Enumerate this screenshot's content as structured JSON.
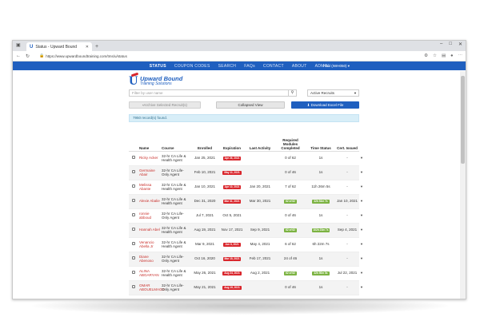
{
  "browser": {
    "tab_title": "Status - Upward Bound",
    "url": "https://www.upwardboundtraining.com/tms/u/status"
  },
  "site": {
    "nav": [
      "STATUS",
      "COUPON CODES",
      "SEARCH",
      "FAQs",
      "CONTACT",
      "ABOUT",
      "ADMIN"
    ],
    "user": "Paul (IWH050)",
    "logo_line1": "Upward Bound",
    "logo_line2": "Training Solutions"
  },
  "controls": {
    "search_placeholder": "Filter by user name",
    "filter_value": "Active Recruits",
    "archive_label": "Archive Selected Recruit(s)",
    "collapsed_label": "Collapsed View",
    "excel_label": "Download Excel File"
  },
  "alert": "7950 record(s) found.",
  "table": {
    "headers": [
      "Name",
      "Course",
      "Enrolled",
      "Expiration",
      "Last Activity",
      "Required Modules Completed",
      "Time Status",
      "Cert. Issued"
    ],
    "rows": [
      {
        "name": "Ricky Acker",
        "course": "32-hr CA Life & Health Agent",
        "enrolled": "Jan 25, 2021",
        "expiration": "Apr 26, 2021",
        "exp_color": "red",
        "last_activity": "",
        "modules": "0 of 62",
        "modules_badge": false,
        "time": "1s",
        "time_badge": false,
        "cert": "-"
      },
      {
        "name": "Germaine Abair",
        "course": "32-hr CA Life-Only Agent",
        "enrolled": "Feb 10, 2021",
        "expiration": "May 11, 2021",
        "exp_color": "red",
        "last_activity": "",
        "modules": "0 of 46",
        "modules_badge": false,
        "time": "1s",
        "time_badge": false,
        "cert": "-"
      },
      {
        "name": "Melissa Abante",
        "course": "32-hr CA Life & Health Agent",
        "enrolled": "Jan 10, 2021",
        "expiration": "Apr 10, 2021",
        "exp_color": "red",
        "last_activity": "Jan 20, 2021",
        "modules": "7 of 62",
        "modules_badge": false,
        "time": "11h 26m 5s",
        "time_badge": false,
        "cert": "-"
      },
      {
        "name": "Alexie Abalie",
        "course": "32-hr CA Life & Health Agent",
        "enrolled": "Dec 31, 2020",
        "expiration": "Mar 31, 2021",
        "exp_color": "red",
        "last_activity": "Mar 30, 2021",
        "modules": "62 of 62",
        "modules_badge": true,
        "time": "32h 54m 7s",
        "time_badge": true,
        "cert": "Jan 10, 2021"
      },
      {
        "name": "ronnie abboud",
        "course": "32-hr CA Life-Only Agent",
        "enrolled": "Jul 7, 2021",
        "expiration": "Oct 5, 2021",
        "exp_color": "none",
        "last_activity": "",
        "modules": "0 of 46",
        "modules_badge": false,
        "time": "1s",
        "time_badge": false,
        "cert": "-"
      },
      {
        "name": "Hannah Abel",
        "course": "32-hr CA Life & Health Agent",
        "enrolled": "Aug 19, 2021",
        "expiration": "Nov 17, 2021",
        "exp_color": "none",
        "last_activity": "Sep 9, 2021",
        "modules": "62 of 62",
        "modules_badge": true,
        "time": "102h 23m 7s",
        "time_badge": true,
        "cert": "Sep 4, 2021"
      },
      {
        "name": "Venancio Abella Jr",
        "course": "32-hr CA Life & Health Agent",
        "enrolled": "Mar 9, 2021",
        "expiration": "Jun 8, 2021",
        "exp_color": "red",
        "last_activity": "May 4, 2021",
        "modules": "6 of 62",
        "modules_badge": false,
        "time": "6h 22m 7s",
        "time_badge": false,
        "cert": "-"
      },
      {
        "name": "Diane Abenoso",
        "course": "32-hr CA Life-Only Agent",
        "enrolled": "Oct 16, 2020",
        "expiration": "Mar 15, 2021",
        "exp_color": "red",
        "last_activity": "Feb 17, 2021",
        "modules": "24 of 46",
        "modules_badge": false,
        "time": "1s",
        "time_badge": false,
        "cert": "-"
      },
      {
        "name": "ALINA ABGARYAN",
        "course": "32-hr CA Life & Health Agent",
        "enrolled": "May 26, 2021",
        "expiration": "Aug 24, 2021",
        "exp_color": "red",
        "last_activity": "Aug 2, 2021",
        "modules": "62 of 62",
        "modules_badge": true,
        "time": "32h 50m 5s",
        "time_badge": true,
        "cert": "Jul 22, 2021"
      },
      {
        "name": "OMAR ABOUELMAGD",
        "course": "32-hr CA Life-Only Agent",
        "enrolled": "May 21, 2021",
        "expiration": "Aug 19, 2021",
        "exp_color": "red",
        "last_activity": "",
        "modules": "0 of 46",
        "modules_badge": false,
        "time": "1s",
        "time_badge": false,
        "cert": "-"
      }
    ]
  },
  "colors": {
    "brand_blue": "#1f5fbf",
    "danger_red": "#d9262c",
    "success_green": "#7cb342",
    "name_red": "#c9302c"
  }
}
